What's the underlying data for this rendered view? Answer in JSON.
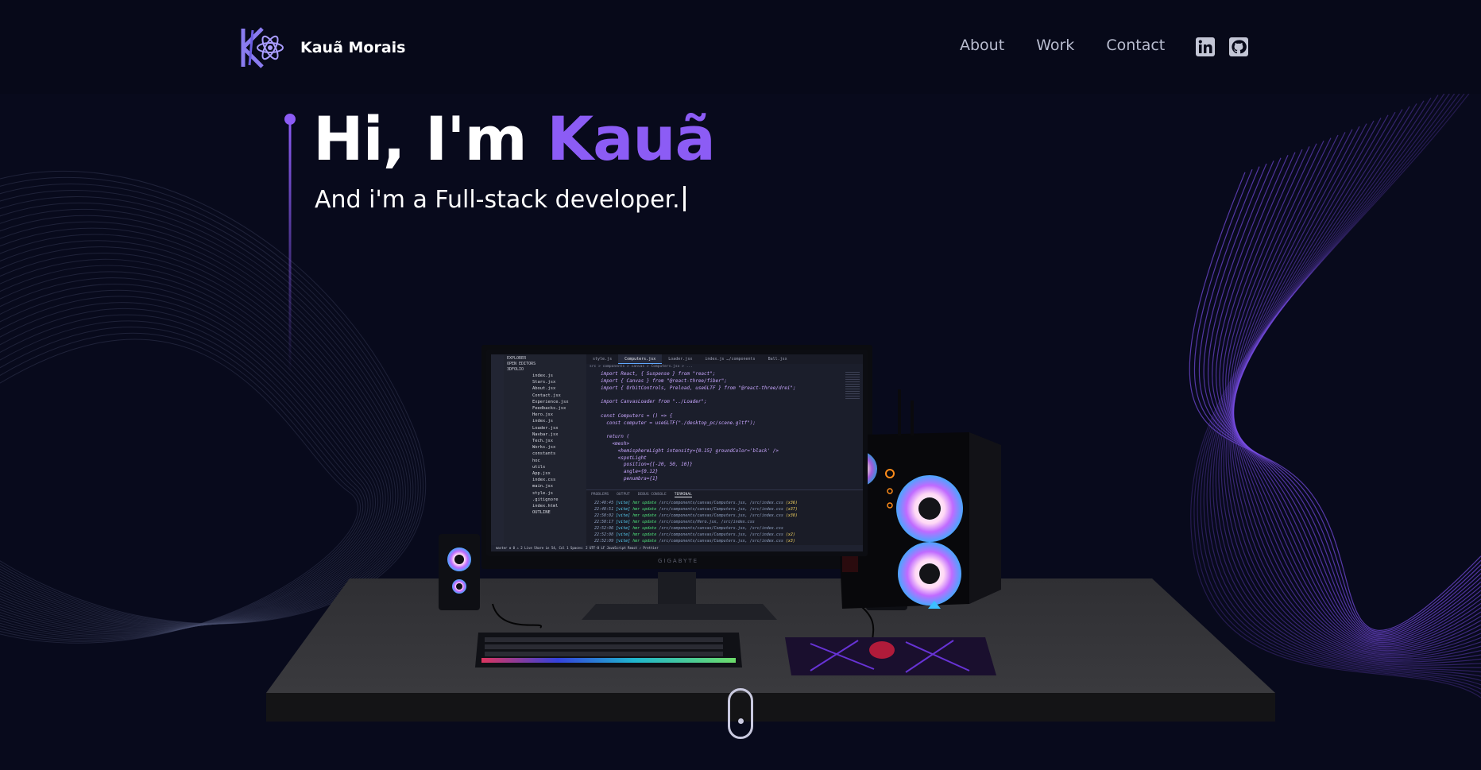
{
  "navbar": {
    "brand_name": "Kauã Morais",
    "links": [
      "About",
      "Work",
      "Contact"
    ],
    "social_icons": [
      "linkedin-icon",
      "github-icon"
    ]
  },
  "hero": {
    "greeting": "Hi, I'm ",
    "name": "Kauã",
    "subtitle": "And i'm a Full-stack developer."
  },
  "editor": {
    "sidebar_header": [
      "EXPLORER",
      "OPEN EDITORS",
      "3DFOLIO"
    ],
    "files": [
      "index.js",
      "Stars.jsx",
      "About.jsx",
      "Contact.jsx",
      "Experience.jsx",
      "Feedbacks.jsx",
      "Hero.jsx",
      "index.js",
      "Loader.jsx",
      "Navbar.jsx",
      "Tech.jsx",
      "Works.jsx",
      "constants",
      "hoc",
      "utils",
      "App.jsx",
      "index.css",
      "main.jsx",
      "style.js",
      ".gitignore",
      "index.html",
      "OUTLINE"
    ],
    "tabs": [
      "style.js",
      "Computers.jsx",
      "Loader.jsx",
      "index.js …/components",
      "Ball.jsx"
    ],
    "breadcrumb": "src > components > canvas > Computers.jsx > ...",
    "code": [
      "import React, { Suspense } from \"react\";",
      "import { Canvas } from \"@react-three/fiber\";",
      "import { OrbitControls, Preload, useGLTF } from \"@react-three/drei\";",
      "",
      "import CanvasLoader from \"../Loader\";",
      "",
      "const Computers = () => {",
      "  const computer = useGLTF(\"./desktop_pc/scene.gltf\");",
      "",
      "  return (",
      "    <mesh>",
      "      <hemisphereLight intensity={0.15} groundColor='black' />",
      "      <spotLight",
      "        position={[-20, 50, 10]}",
      "        angle={0.12}",
      "        penumbra={1}"
    ],
    "panel_tabs": [
      "PROBLEMS",
      "OUTPUT",
      "DEBUG CONSOLE",
      "TERMINAL"
    ],
    "terminal": [
      {
        "time": "22:48:45",
        "path": "/src/components/canvas/Computers.jsx, /src/index.css",
        "count": "(x36)"
      },
      {
        "time": "22:48:51",
        "path": "/src/components/canvas/Computers.jsx, /src/index.css",
        "count": "(x37)"
      },
      {
        "time": "22:50:02",
        "path": "/src/components/canvas/Computers.jsx, /src/index.css",
        "count": "(x38)"
      },
      {
        "time": "22:50:17",
        "path": "/src/components/Hero.jsx, /src/index.css",
        "count": ""
      },
      {
        "time": "22:52:06",
        "path": "/src/components/canvas/Computers.jsx, /src/index.css",
        "count": ""
      },
      {
        "time": "22:52:08",
        "path": "/src/components/canvas/Computers.jsx, /src/index.css",
        "count": "(x2)"
      },
      {
        "time": "22:52:09",
        "path": "/src/components/canvas/Computers.jsx, /src/index.css",
        "count": "(x3)"
      }
    ],
    "status": "master   ⊗ 0 ⚠ 2   Live Share              Ln 54, Col 1   Spaces: 2   UTF-8   LF   JavaScript React   ✓ Prettier",
    "monitor_brand": "GIGABYTE"
  },
  "colors": {
    "background": "#080a1c",
    "accent": "#8c5cf5",
    "nav_text": "#b8bccf",
    "wave": "#7a4ee8"
  }
}
